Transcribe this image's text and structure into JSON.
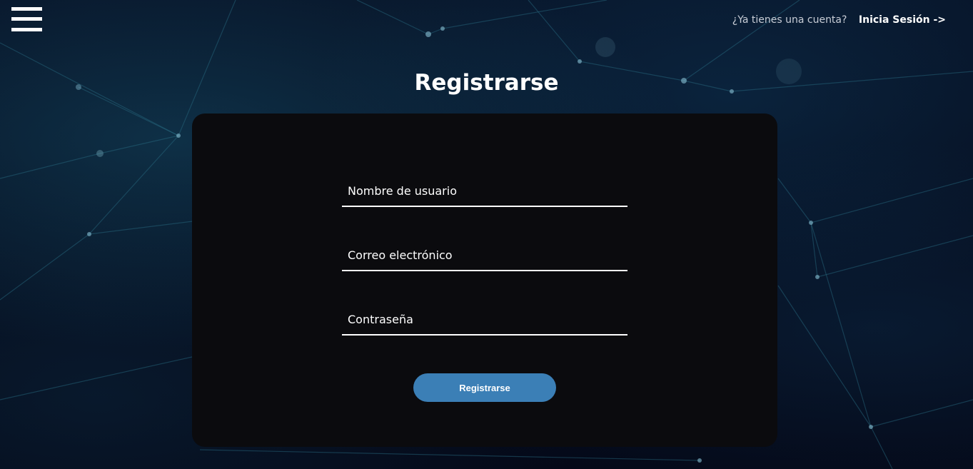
{
  "header": {
    "menu_icon": "hamburger-menu-icon",
    "account_question": "¿Ya tienes una cuenta?",
    "login_link": "Inicia Sesión ->"
  },
  "page": {
    "title": "Registrarse"
  },
  "form": {
    "username_placeholder": "Nombre de usuario",
    "email_placeholder": "Correo electrónico",
    "password_placeholder": "Contraseña",
    "submit_label": "Registrarse"
  },
  "colors": {
    "background": "#050a1c",
    "card": "#0b0b0e",
    "button": "#3b7fb6",
    "text": "#ffffff"
  }
}
